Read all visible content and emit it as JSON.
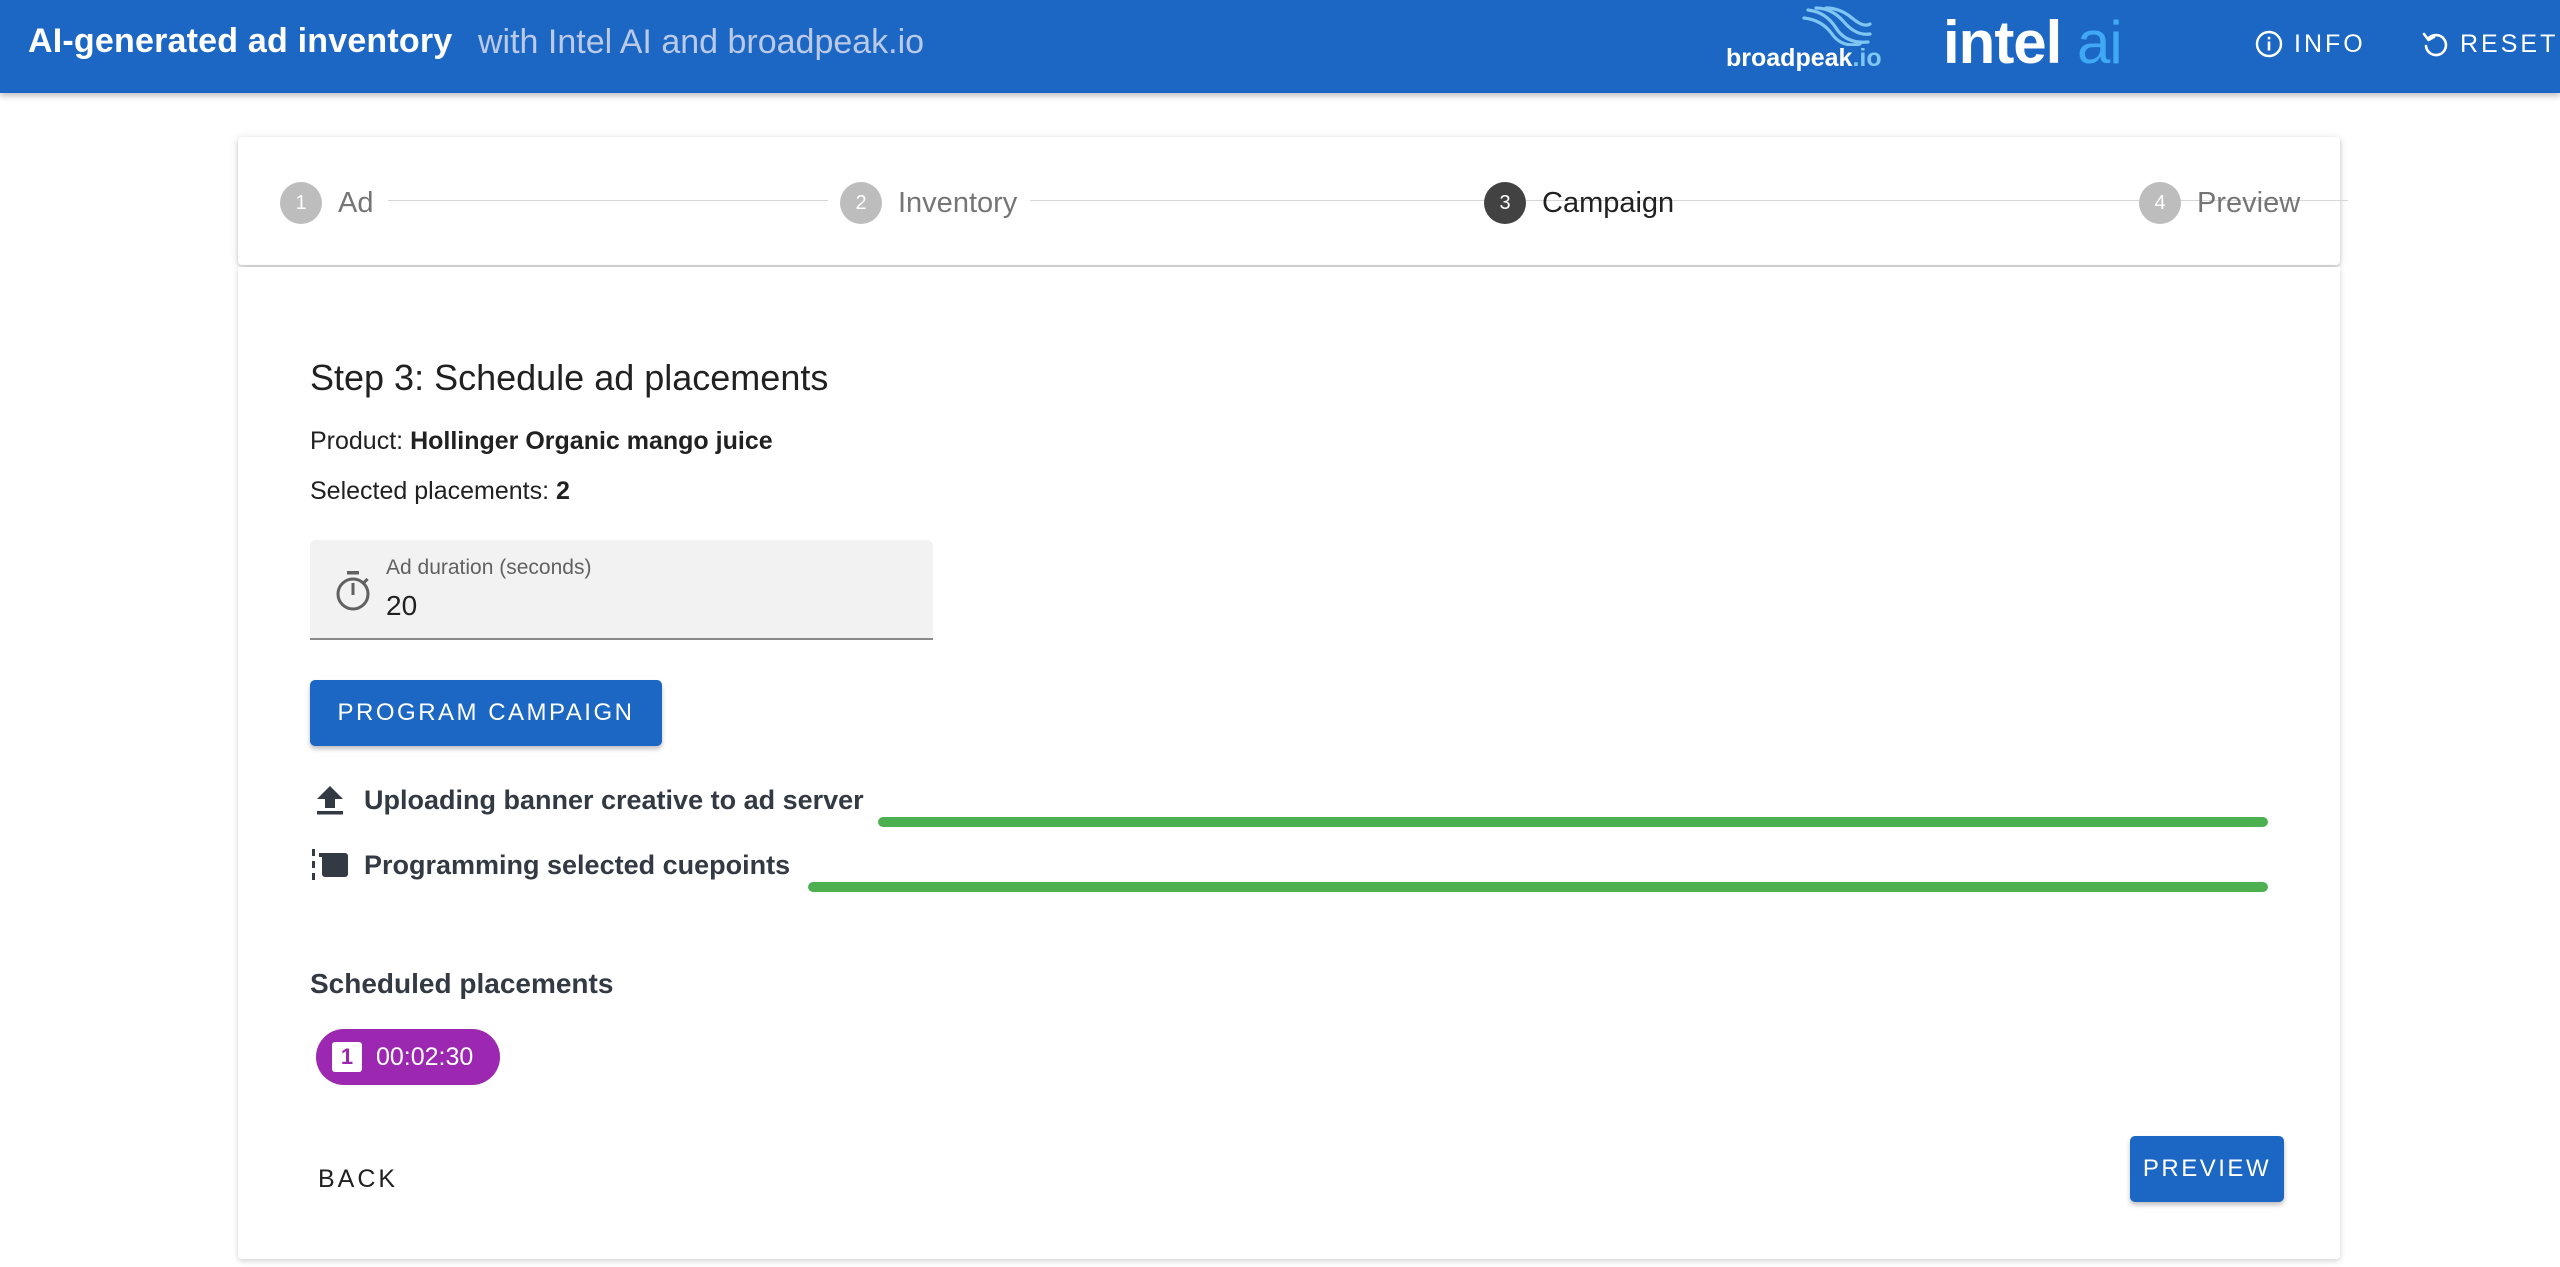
{
  "appbar": {
    "title": "AI-generated ad inventory",
    "subtitle": "with Intel AI and broadpeak.io",
    "broadpeak_logo": {
      "text_main": "broadpeak",
      "text_suffix": ".io",
      "icon": "broadpeak-waves-icon"
    },
    "intel_logo": {
      "text_main": "intel",
      "text_suffix": "ai"
    },
    "info_label": "INFO",
    "reset_label": "RESET",
    "colors": {
      "background": "#1d67c4",
      "accent_light": "#3fa9f5"
    }
  },
  "stepper": {
    "steps": [
      {
        "number": "1",
        "label": "Ad",
        "state": "inactive"
      },
      {
        "number": "2",
        "label": "Inventory",
        "state": "inactive"
      },
      {
        "number": "3",
        "label": "Campaign",
        "state": "active"
      },
      {
        "number": "4",
        "label": "Preview",
        "state": "inactive"
      }
    ]
  },
  "main": {
    "heading": "Step 3: Schedule ad placements",
    "product_label": "Product:",
    "product_value": "Hollinger Organic mango juice",
    "placements_label": "Selected placements:",
    "placements_value": "2",
    "duration_field": {
      "label": "Ad duration (seconds)",
      "value": "20",
      "icon": "timer-icon"
    },
    "program_button": "PROGRAM CAMPAIGN",
    "progress": [
      {
        "icon": "upload-icon",
        "label": "Uploading banner creative to ad server",
        "value": 1.0
      },
      {
        "icon": "cuepoint-icon",
        "label": "Programming selected cuepoints",
        "value": 1.0
      }
    ],
    "scheduled_heading": "Scheduled placements",
    "scheduled": [
      {
        "badge": "1",
        "time": "00:02:30",
        "color": "#9c27b0"
      }
    ],
    "back_button": "BACK",
    "preview_button": "PREVIEW",
    "colors": {
      "primary": "#1d67c4",
      "progress": "#4caf50",
      "chip": "#9c27b0"
    }
  }
}
